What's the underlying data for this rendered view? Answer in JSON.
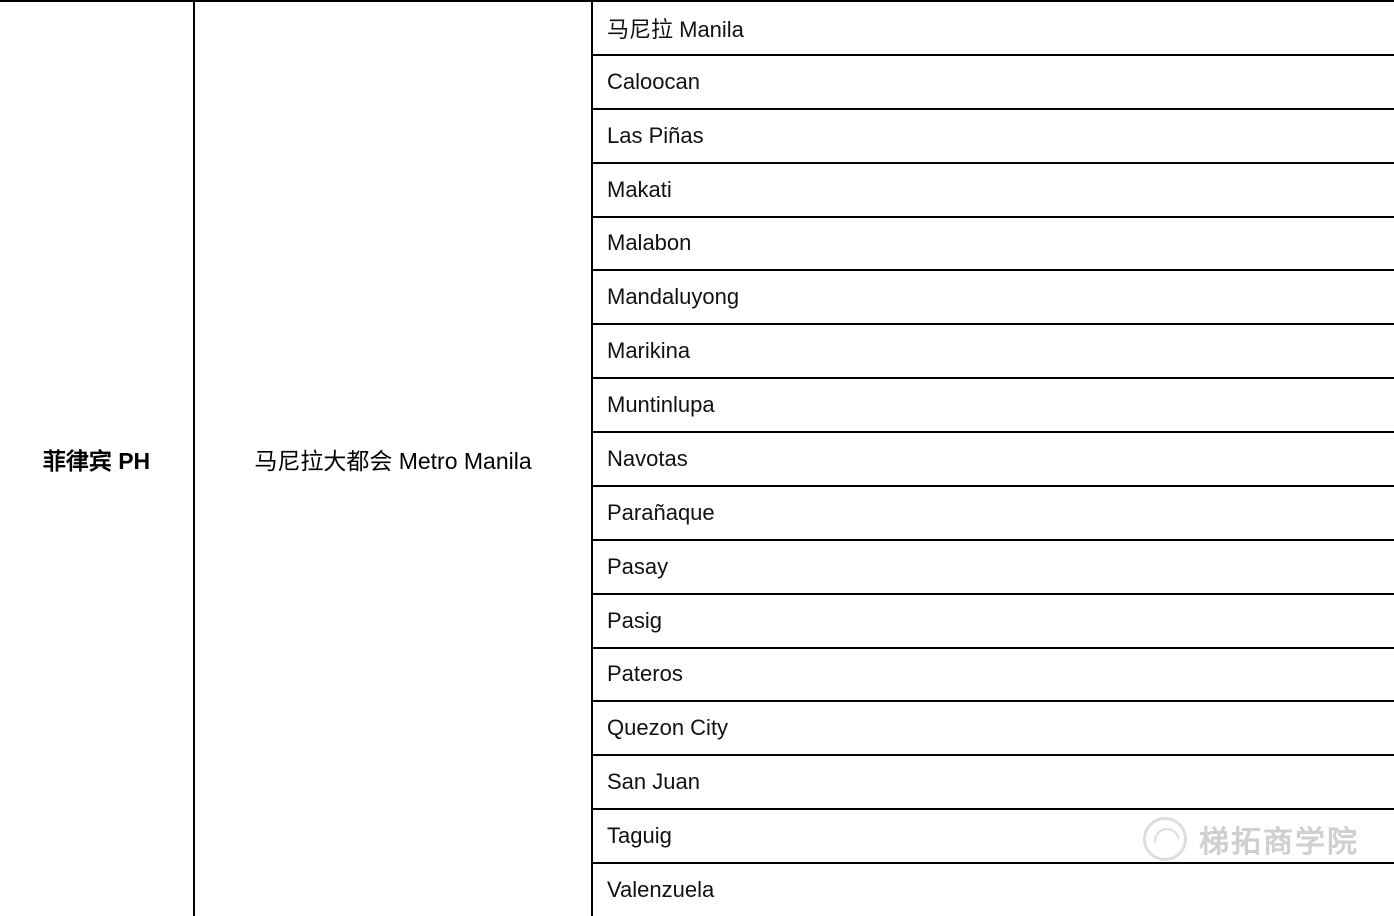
{
  "table": {
    "country": "菲律宾 PH",
    "region": "马尼拉大都会 Metro Manila",
    "cities": [
      "马尼拉 Manila",
      "Caloocan",
      "Las Piñas",
      "Makati",
      "Malabon",
      "Mandaluyong",
      "Marikina",
      "Muntinlupa",
      "Navotas",
      "Parañaque",
      "Pasay",
      "Pasig",
      "Pateros",
      "Quezon City",
      "San Juan",
      "Taguig",
      "Valenzuela"
    ]
  },
  "watermark": "梯拓商学院"
}
